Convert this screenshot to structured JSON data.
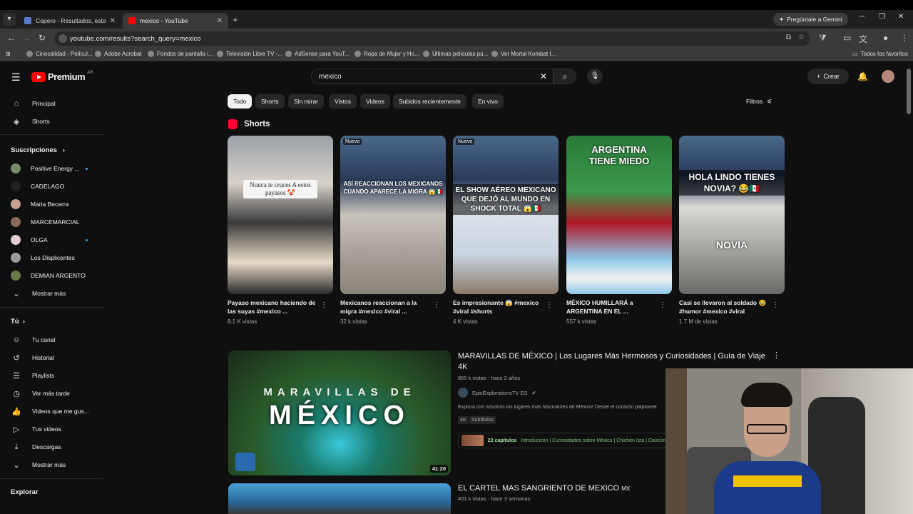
{
  "browser": {
    "tabs": [
      {
        "title": "Copero - Resultados, estadística",
        "active": false
      },
      {
        "title": "mexico - YouTube",
        "active": true
      }
    ],
    "gemini_label": "Pregúntale a Gemini",
    "url": "youtube.com/results?search_query=mexico",
    "bookmarks": [
      "Cinecalidad - Películ...",
      "Adobe Acrobat",
      "Fondos de pantalla i...",
      "Televisión Libre TV -...",
      "AdSense para YouT...",
      "Ropa de Mujer y Ho...",
      "Últimas películas pu...",
      "Ver Mortal Kombat I..."
    ],
    "all_bookmarks": "Todos los favoritos"
  },
  "youtube": {
    "logo": "Premium",
    "country": "AR",
    "search_query": "mexico",
    "create_label": "Crear",
    "colors": {
      "accent": "#ff0000",
      "bg": "#0f0f0f"
    }
  },
  "sidebar": {
    "main": [
      {
        "label": "Principal",
        "icon": "home-icon"
      },
      {
        "label": "Shorts",
        "icon": "shorts-icon"
      }
    ],
    "subs_header": "Suscripciones",
    "subscriptions": [
      {
        "label": "Positive Energy ...",
        "color": "#7a8a6a",
        "new": true
      },
      {
        "label": "CADELAGO",
        "color": "#222222",
        "new": false
      },
      {
        "label": "Maria Becerra",
        "color": "#c8a090",
        "new": false
      },
      {
        "label": "MARCEMARCIAL",
        "color": "#8a6a5a",
        "new": false
      },
      {
        "label": "OLGA",
        "color": "#e0d0d0",
        "new": true
      },
      {
        "label": "Los Displicentes",
        "color": "#9a9a9a",
        "new": false
      },
      {
        "label": "DEMIAN ARGENTO",
        "color": "#6a7a4a",
        "new": false
      }
    ],
    "show_more": "Mostrar más",
    "you_header": "Tú",
    "you_items": [
      {
        "label": "Tu canal",
        "icon": "account-icon"
      },
      {
        "label": "Historial",
        "icon": "history-icon"
      },
      {
        "label": "Playlists",
        "icon": "playlist-icon"
      },
      {
        "label": "Ver más tarde",
        "icon": "clock-icon"
      },
      {
        "label": "Videos que me gus...",
        "icon": "like-icon"
      },
      {
        "label": "Tus videos",
        "icon": "video-icon"
      },
      {
        "label": "Descargas",
        "icon": "download-icon"
      },
      {
        "label": "Mostrar más",
        "icon": "chevron-down-icon"
      }
    ],
    "explore_header": "Explorar"
  },
  "chips": [
    "Todo",
    "Shorts",
    "Sin mirar",
    "Vistos",
    "Videos",
    "Subidos recientemente",
    "En vivo"
  ],
  "filters_label": "Filtros",
  "shorts_header": "Shorts",
  "shorts": [
    {
      "title": "Payaso mexicano haciendo de las suyas #mexico ...",
      "views": "8.1 K vistas",
      "overlay": "Nunca te cruces A estos payasos 🤡",
      "badge": ""
    },
    {
      "title": "Mexicanos reaccionan a la migra #mexico #viral ...",
      "views": "32 k vistas",
      "overlay": "ASÍ REACCIONAN LOS MEXICANOS CUANDO APARECE LA MIGRA 😱🇲🇽",
      "badge": "Nuevo"
    },
    {
      "title": "Es impresionante 😱 #mexico #viral #shorts",
      "views": "4 K vistas",
      "overlay": "EL SHOW AÉREO MEXICANO QUE DEJÓ AL MUNDO EN SHOCK TOTAL 😱🇲🇽",
      "badge": "Nuevo"
    },
    {
      "title": "MÉXICO HUMILLARÁ a ARGENTINA EN EL ...",
      "views": "557 k vistas",
      "overlay": "ARGENTINA TIENE MIEDO",
      "badge": ""
    },
    {
      "title": "Casi se llevaron al soldado 😂 #humor #mexico #viral",
      "views": "1.7 M de vistas",
      "overlay": "HOLA LINDO TIENES NOVIA? 😂🇲🇽",
      "overlay2": "NOVIA",
      "badge": ""
    }
  ],
  "videos": [
    {
      "title": "MARAVILLAS DE MÉXICO | Los Lugares Más Hermosos y Curiosidades | Guía de Viaje 4K",
      "meta": "855 k vistas · hace 2 años",
      "channel": "EpicExplorationsTV ES",
      "description": "Explora con nosotros los lugares más fascinantes de México! Desde el corazón palpitante",
      "badges": [
        "4K",
        "Subtítulos"
      ],
      "chapters_count": "22 capítulos",
      "chapters": "Introducción | Curiosidades sobre México | Chichén Itzá | Cancún",
      "duration": "41:20",
      "thumb_line1": "MARAVILLAS DE",
      "thumb_line2": "MÉXICO"
    },
    {
      "title": "EL CARTEL MAS SANGRIENTO DE MEXICO",
      "title_flag": "MX",
      "meta": "401 k vistas · hace 3 semanas"
    }
  ]
}
